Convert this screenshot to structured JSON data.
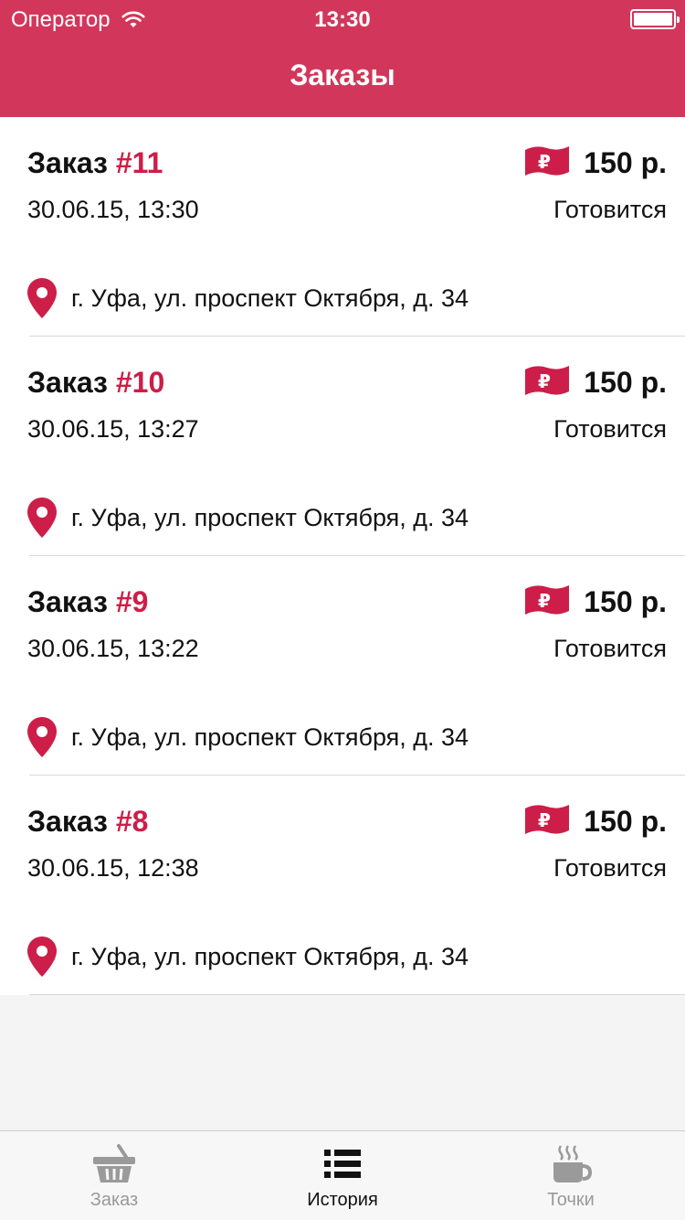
{
  "status_bar": {
    "carrier": "Оператор",
    "time": "13:30"
  },
  "nav": {
    "title": "Заказы"
  },
  "orders": [
    {
      "label": "Заказ",
      "number": "#11",
      "date": "30.06.15, 13:30",
      "price": "150 р.",
      "status": "Готовится",
      "address": "г. Уфа, ул. проспект Октября, д. 34"
    },
    {
      "label": "Заказ",
      "number": "#10",
      "date": "30.06.15, 13:27",
      "price": "150 р.",
      "status": "Готовится",
      "address": "г. Уфа, ул. проспект Октября, д. 34"
    },
    {
      "label": "Заказ",
      "number": "#9",
      "date": "30.06.15, 13:22",
      "price": "150 р.",
      "status": "Готовится",
      "address": "г. Уфа, ул. проспект Октября, д. 34"
    },
    {
      "label": "Заказ",
      "number": "#8",
      "date": "30.06.15, 12:38",
      "price": "150 р.",
      "status": "Готовится",
      "address": "г. Уфа, ул. проспект Октября, д. 34"
    }
  ],
  "tabs": [
    {
      "label": "Заказ",
      "icon": "basket-icon"
    },
    {
      "label": "История",
      "icon": "list-icon"
    },
    {
      "label": "Точки",
      "icon": "coffee-cup-icon"
    }
  ],
  "colors": {
    "accent": "#d2375b",
    "order_number": "#cc1e48",
    "tab_inactive": "#9a9a9a"
  }
}
